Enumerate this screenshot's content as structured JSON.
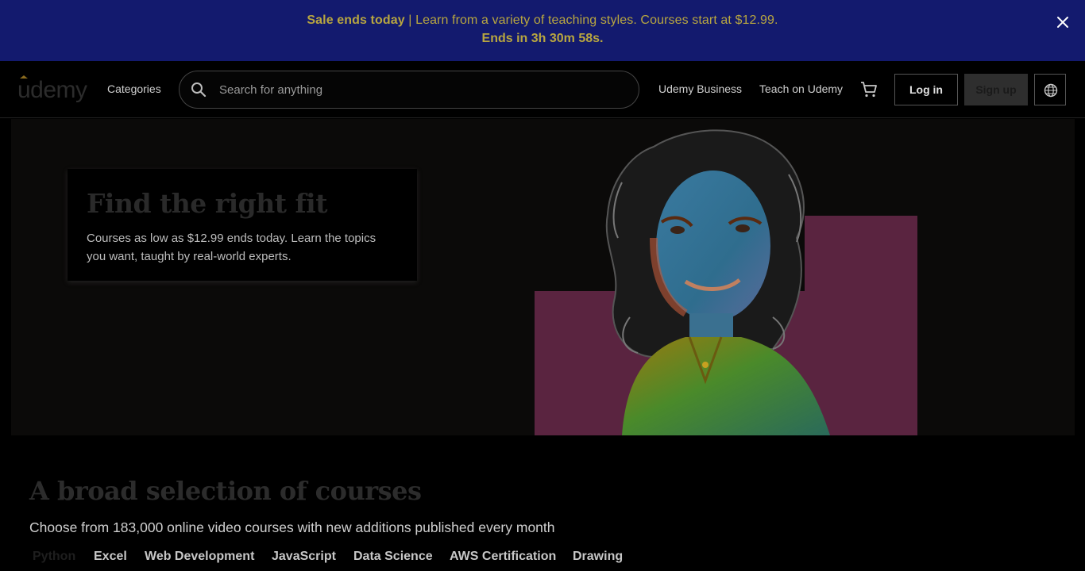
{
  "banner": {
    "headline": "Sale ends today",
    "message": " | Learn from a variety of teaching styles. Courses start at $12.99.",
    "countdown": "Ends in 3h 30m 58s.",
    "close_icon": "close-icon"
  },
  "header": {
    "logo_text": "udemy",
    "categories_label": "Categories",
    "search_placeholder": "Search for anything",
    "business_label": "Udemy Business",
    "teach_label": "Teach on Udemy",
    "cart_icon": "cart-icon",
    "login_label": "Log in",
    "signup_label": "Sign up",
    "language_icon": "globe-icon"
  },
  "hero": {
    "title": "Find the right fit",
    "subtitle": "Courses as low as $12.99 ends today. Learn the topics you want, taught by real-world experts."
  },
  "courses": {
    "title": "A broad selection of courses",
    "subtitle": "Choose from 183,000 online video courses with new additions published every month",
    "topics": [
      "Python",
      "Excel",
      "Web Development",
      "JavaScript",
      "Data Science",
      "AWS Certification",
      "Drawing"
    ],
    "active_topic": "Python"
  },
  "colors": {
    "banner_bg": "#131a6e",
    "banner_text": "#b8a640",
    "hero_accent": "#5a2440"
  }
}
